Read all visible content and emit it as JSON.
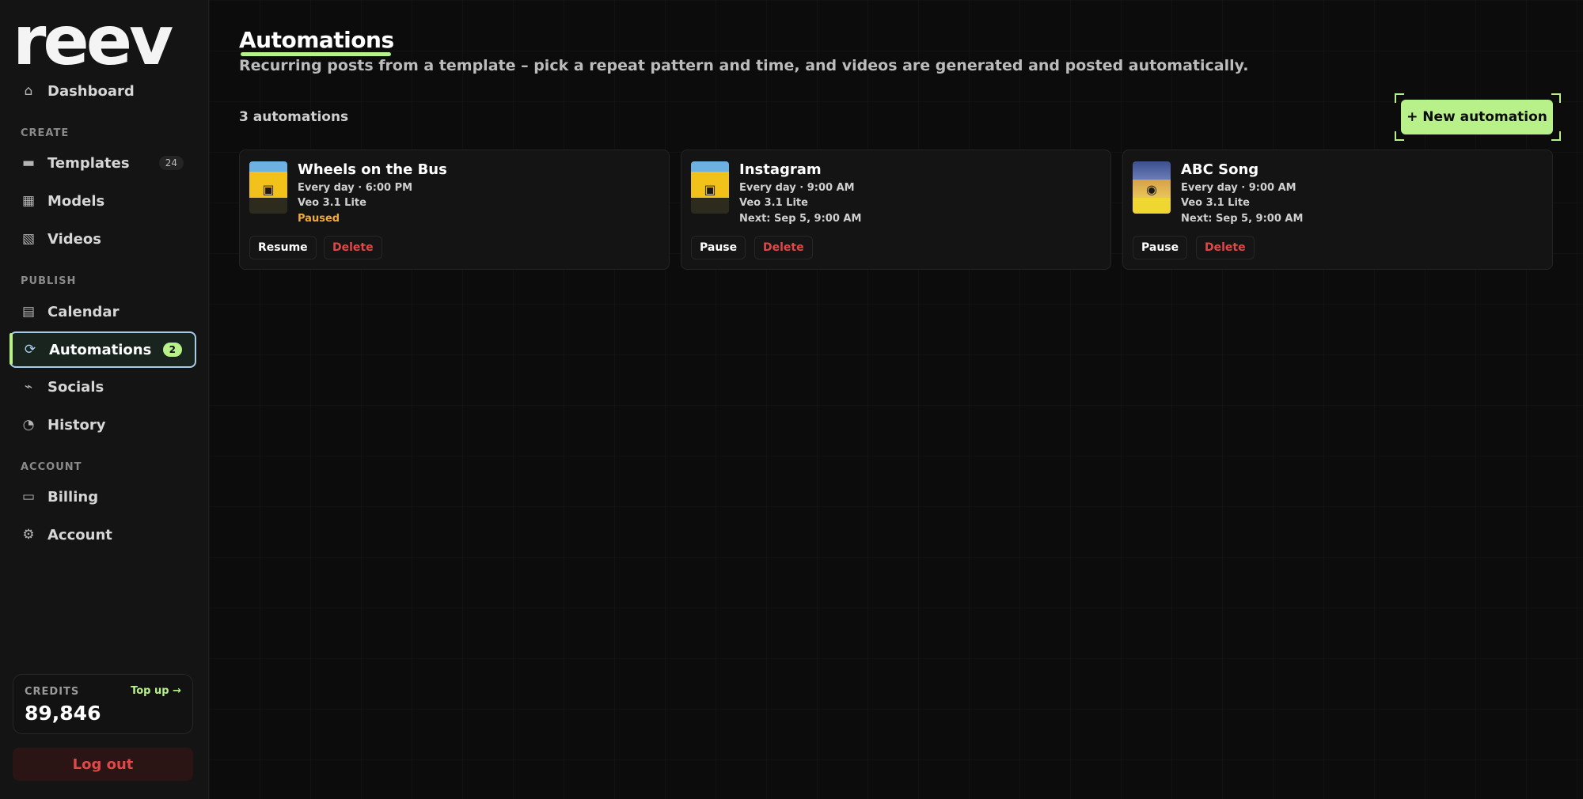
{
  "app": {
    "logo": "reev"
  },
  "sidebar": {
    "nav": [
      {
        "label": "Dashboard",
        "icon": "home-icon"
      },
      {
        "section": "CREATE"
      },
      {
        "label": "Templates",
        "icon": "folder-icon",
        "badge": "24"
      },
      {
        "label": "Models",
        "icon": "grid-icon"
      },
      {
        "label": "Videos",
        "icon": "clapper-icon"
      },
      {
        "section": "PUBLISH"
      },
      {
        "label": "Calendar",
        "icon": "calendar-icon"
      },
      {
        "label": "Automations",
        "icon": "repeat-icon",
        "badge": "2",
        "active": true
      },
      {
        "label": "Socials",
        "icon": "plug-icon"
      },
      {
        "label": "History",
        "icon": "clock-icon"
      },
      {
        "section": "ACCOUNT"
      },
      {
        "label": "Billing",
        "icon": "card-icon"
      },
      {
        "label": "Account",
        "icon": "gear-icon"
      }
    ],
    "labels": {
      "dashboard": "Dashboard",
      "create": "CREATE",
      "templates": "Templates",
      "templates_badge": "24",
      "models": "Models",
      "videos": "Videos",
      "publish": "PUBLISH",
      "calendar": "Calendar",
      "automations": "Automations",
      "automations_badge": "2",
      "socials": "Socials",
      "history": "History",
      "account_section": "ACCOUNT",
      "billing": "Billing",
      "account": "Account"
    },
    "credits": {
      "label": "CREDITS",
      "topup": "Top up →",
      "value": "89,846"
    },
    "logout": "Log out"
  },
  "main": {
    "title": "Automations",
    "subtitle": "Recurring posts from a template – pick a repeat pattern and time, and videos are generated and posted automatically.",
    "count": "3 automations",
    "new_button": "+ New automation",
    "cards": [
      {
        "title": "Wheels on the Bus",
        "schedule": "Every day · 6:00 PM",
        "model": "Veo 3.1 Lite",
        "status": "Paused",
        "primary_action": "Resume",
        "delete": "Delete"
      },
      {
        "title": "Instagram",
        "schedule": "Every day · 9:00 AM",
        "model": "Veo 3.1 Lite",
        "status": "Next: Sep 5, 9:00 AM",
        "primary_action": "Pause",
        "delete": "Delete"
      },
      {
        "title": "ABC Song",
        "schedule": "Every day · 9:00 AM",
        "model": "Veo 3.1 Lite",
        "status": "Next: Sep 5, 9:00 AM",
        "primary_action": "Pause",
        "delete": "Delete"
      }
    ]
  },
  "colors": {
    "accent": "#b8f08a",
    "danger": "#e04848",
    "paused": "#f0a93a",
    "active_border": "#a9cde8"
  }
}
